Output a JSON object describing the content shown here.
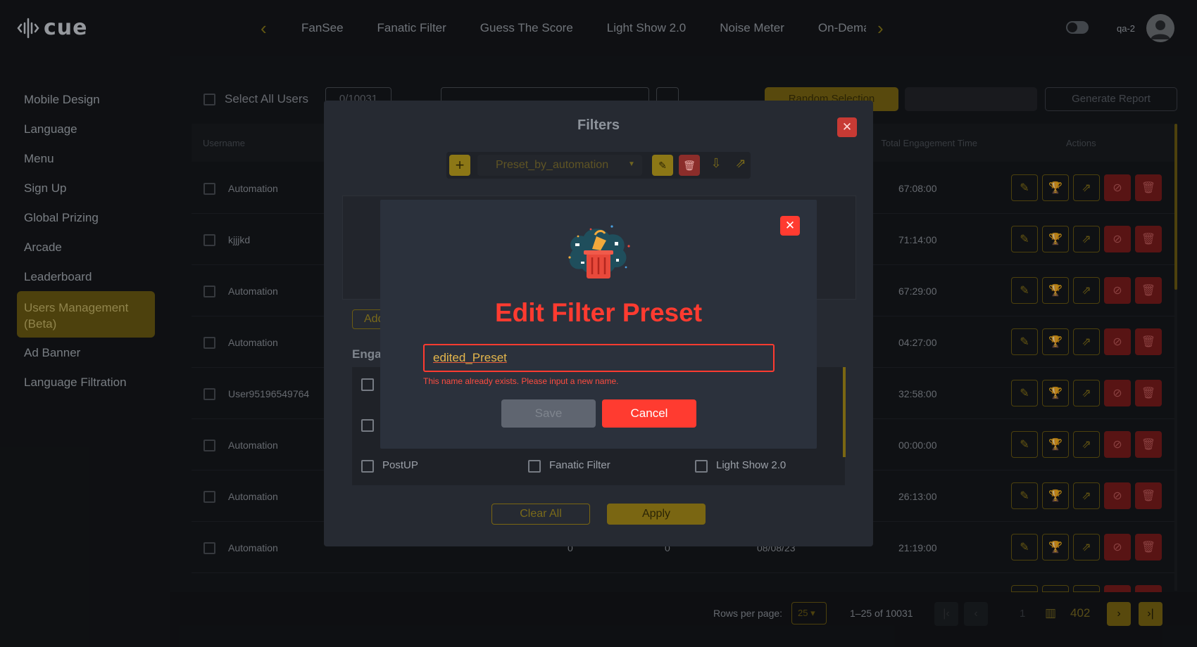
{
  "header": {
    "logo_text": "cue",
    "tabs": [
      "FanSee",
      "Fanatic Filter",
      "Guess The Score",
      "Light Show 2.0",
      "Noise Meter",
      "On-Demand"
    ],
    "user_name": "qa-2"
  },
  "sidebar": {
    "items": [
      {
        "label": "Mobile Design"
      },
      {
        "label": "Language"
      },
      {
        "label": "Menu"
      },
      {
        "label": "Sign Up"
      },
      {
        "label": "Global Prizing"
      },
      {
        "label": "Arcade"
      },
      {
        "label": "Leaderboard"
      },
      {
        "label": "Users Management (Beta)",
        "active": true
      },
      {
        "label": "Ad Banner"
      },
      {
        "label": "Language Filtration"
      }
    ]
  },
  "toolbar": {
    "select_all_label": "Select All Users",
    "selected_count": "0/10031",
    "random_selection_label": "Random Selection",
    "generate_report_label": "Generate Report"
  },
  "table": {
    "headers": {
      "username": "Username",
      "engagement": "Total Engagement Time",
      "actions": "Actions"
    },
    "rows": [
      {
        "username": "Automation",
        "time": "67:08:00"
      },
      {
        "username": "kjjjkd",
        "time": "71:14:00"
      },
      {
        "username": "Automation",
        "time": "67:29:00"
      },
      {
        "username": "Automation",
        "time": "04:27:00"
      },
      {
        "username": "User95196549764",
        "time": "32:58:00"
      },
      {
        "username": "Automation",
        "time": "00:00:00"
      },
      {
        "username": "Automation",
        "time": "26:13:00"
      },
      {
        "username": "Automation",
        "time": "21:19:00"
      }
    ],
    "last_row_partial": {
      "c1": "0",
      "c2": "0",
      "date": "08/08/23"
    }
  },
  "pagination": {
    "rows_per_page_label": "Rows per page:",
    "rows_per_page": "25",
    "range": "1–25 of 10031",
    "current_page": "1",
    "total_pages": "402"
  },
  "filters_modal": {
    "title": "Filters",
    "preset_name": "Preset_by_automation",
    "add_button_label": "Add",
    "engagement_label": "Engagement",
    "engagement_items": [
      "PostUP",
      "Fanatic Filter",
      "Light Show 2.0"
    ],
    "clear_all_label": "Clear All",
    "apply_label": "Apply"
  },
  "edit_dialog": {
    "title": "Edit Filter Preset",
    "input_value": "edited_Preset",
    "error_message": "This name already exists. Please input a new name.",
    "save_label": "Save",
    "cancel_label": "Cancel"
  },
  "colors": {
    "accent": "#7a6612",
    "danger": "#ff3b30",
    "background": "#131417"
  }
}
